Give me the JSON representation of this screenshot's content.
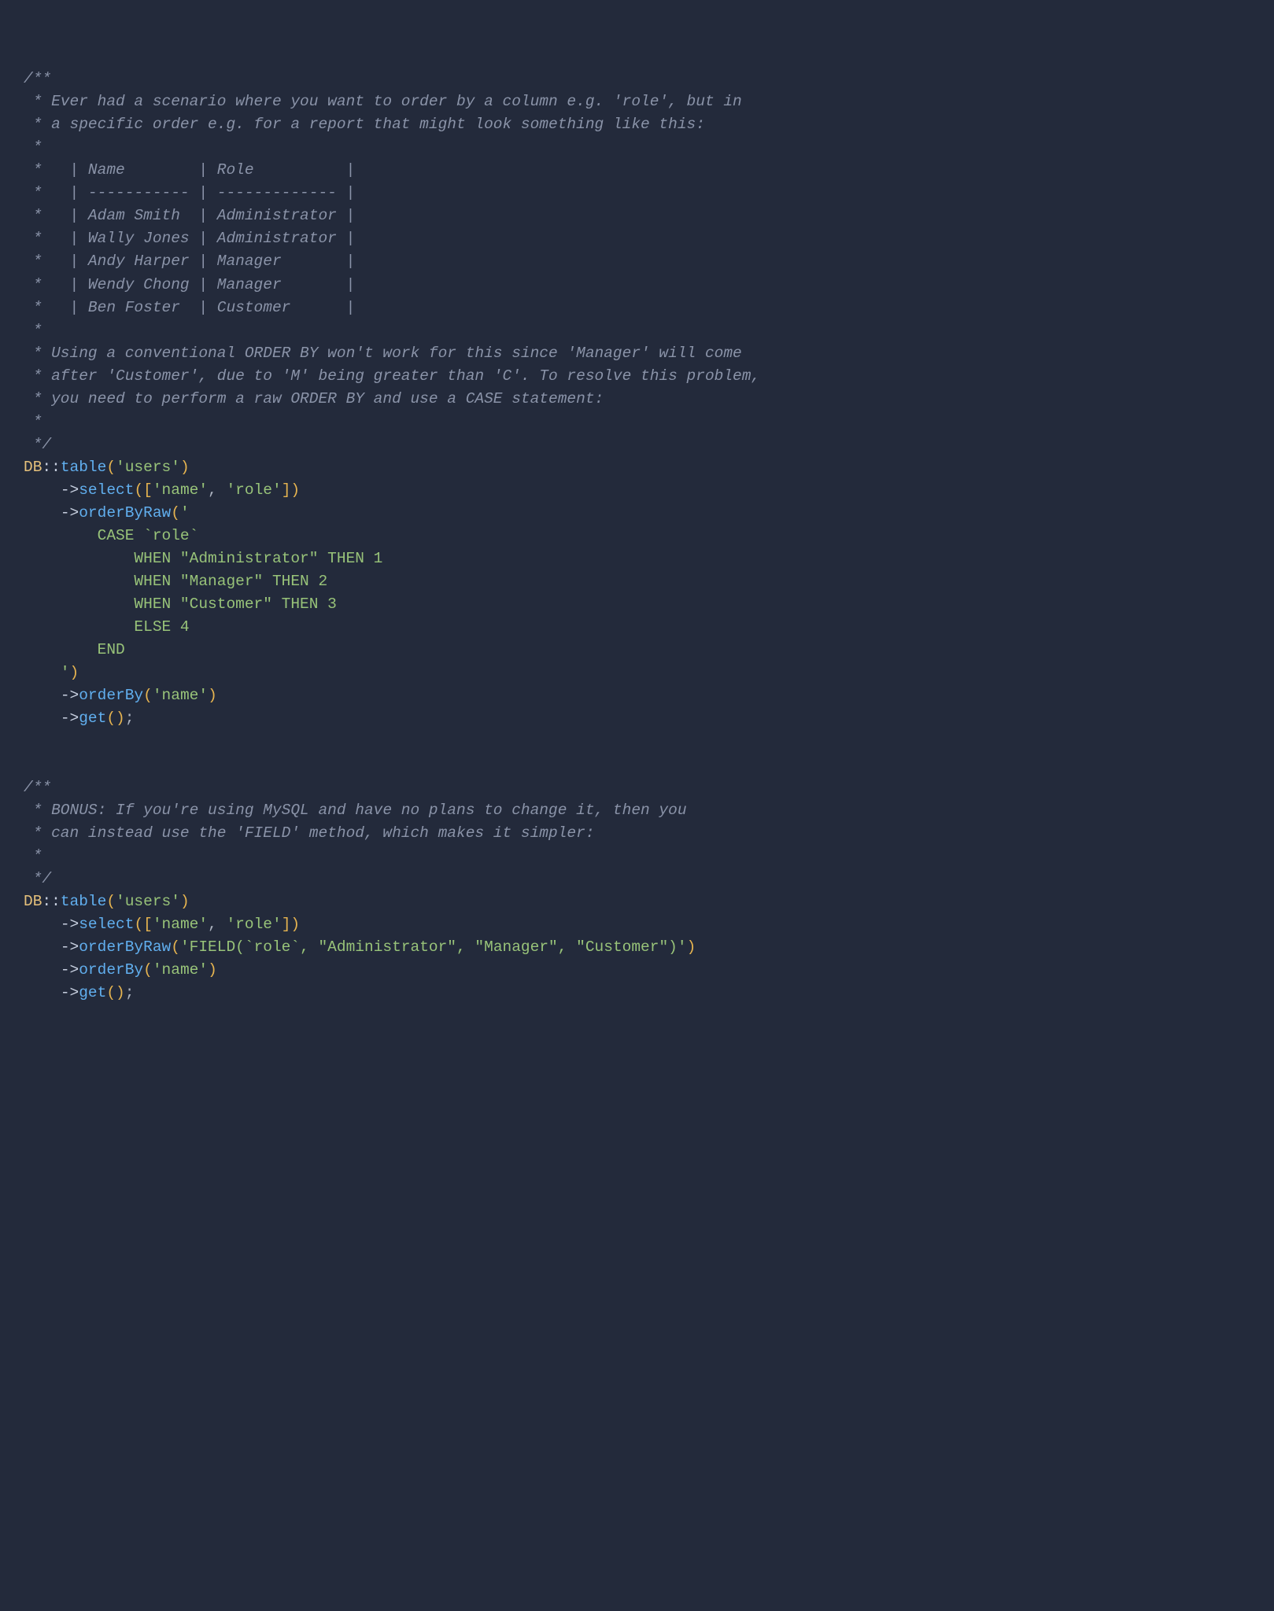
{
  "comment1": {
    "l00": "/**",
    "l01": " * Ever had a scenario where you want to order by a column e.g. 'role', but in",
    "l02": " * a specific order e.g. for a report that might look something like this:",
    "l03": " *",
    "l04": " *   | Name        | Role          |",
    "l05": " *   | ----------- | ------------- |",
    "l06": " *   | Adam Smith  | Administrator |",
    "l07": " *   | Wally Jones | Administrator |",
    "l08": " *   | Andy Harper | Manager       |",
    "l09": " *   | Wendy Chong | Manager       |",
    "l10": " *   | Ben Foster  | Customer      |",
    "l11": " *",
    "l12": " * Using a conventional ORDER BY won't work for this since 'Manager' will come",
    "l13": " * after 'Customer', due to 'M' being greater than 'C'. To resolve this problem,",
    "l14": " * you need to perform a raw ORDER BY and use a CASE statement:",
    "l15": " *",
    "l16": " */"
  },
  "code1": {
    "db": "DB",
    "dbl": "::",
    "table": "table",
    "po": "(",
    "pc": ")",
    "bo": "[",
    "bc": "]",
    "users": "'users'",
    "arrow": "->",
    "select": "select",
    "name": "'name'",
    "comma": ", ",
    "role": "'role'",
    "orderByRaw": "orderByRaw",
    "rawOpen": "'",
    "raw_l1": "        CASE `role`",
    "raw_l2": "            WHEN \"Administrator\" THEN 1",
    "raw_l3": "            WHEN \"Manager\" THEN 2",
    "raw_l4": "            WHEN \"Customer\" THEN 3",
    "raw_l5": "            ELSE 4",
    "raw_l6": "        END",
    "raw_l7": "    '",
    "orderBy": "orderBy",
    "get": "get",
    "sc": ";"
  },
  "comment2": {
    "l00": "/**",
    "l01": " * BONUS: If you're using MySQL and have no plans to change it, then you",
    "l02": " * can instead use the 'FIELD' method, which makes it simpler:",
    "l03": " *",
    "l04": " */"
  },
  "code2": {
    "fieldRaw": "'FIELD(`role`, \"Administrator\", \"Manager\", \"Customer\")'"
  }
}
